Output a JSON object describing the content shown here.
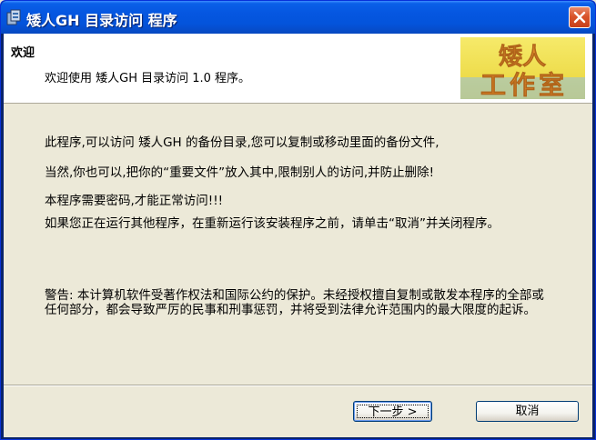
{
  "window": {
    "title": "矮人GH 目录访问 程序"
  },
  "header": {
    "title": "欢迎",
    "subtitle": "欢迎使用 矮人GH 目录访问 1.0 程序。",
    "logo_line1": "矮人",
    "logo_line2": "工作室"
  },
  "body": {
    "para1": "此程序,可以访问 矮人GH 的备份目录,您可以复制或移动里面的备份文件,",
    "para2": "当然,你也可以,把你的“重要文件”放入其中,限制别人的访问,并防止删除!",
    "para3": "本程序需要密码,才能正常访问!!!",
    "para4": "如果您正在运行其他程序，在重新运行该安装程序之前，请单击“取消”并关闭程序。",
    "warning": "警告: 本计算机软件受著作权法和国际公约的保护。未经授权擅自复制或散发本程序的全部或任何部分，都会导致严厉的民事和刑事惩罚，并将受到法律允许范围内的最大限度的起诉。"
  },
  "buttons": {
    "next": "下一步 >",
    "cancel": "取消"
  },
  "colors": {
    "titlebar": "#0556e0",
    "dialog_bg": "#ece9d8",
    "logo_bg": "#f2e24a",
    "logo_text": "#e08a2a"
  }
}
